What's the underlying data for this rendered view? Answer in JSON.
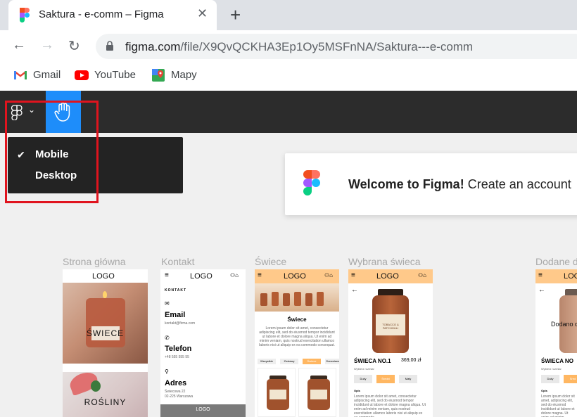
{
  "tab": {
    "title": "Saktura - e-comm – Figma",
    "close": "✕",
    "new": "+"
  },
  "toolbar": {
    "back": "←",
    "forward": "→",
    "reload": "↻",
    "url_domain": "figma.com",
    "url_path": "/file/X9QvQCKHA3Ep1Oy5MSFnNA/Saktura---e-comm"
  },
  "bookmarks": [
    {
      "label": "Gmail"
    },
    {
      "label": "YouTube"
    },
    {
      "label": "Mapy"
    }
  ],
  "dropdown": {
    "items": [
      {
        "label": "Mobile",
        "checked": true
      },
      {
        "label": "Desktop",
        "checked": false
      }
    ]
  },
  "welcome": {
    "bold": "Welcome to Figma!",
    "rest": " Create an account"
  },
  "frames": [
    {
      "label": "Strona główna"
    },
    {
      "label": "Kontakt"
    },
    {
      "label": "Świece"
    },
    {
      "label": "Wybrana świeca"
    },
    {
      "label": "Dodane d"
    }
  ],
  "home": {
    "logo": "LOGO",
    "tile1": "ŚWIECE",
    "tile2": "ROŚLINY"
  },
  "contact": {
    "logo": "LOGO",
    "heading": "KONTAKT",
    "email_label": "Email",
    "email": "kontakt@firma.com",
    "phone_label": "Telefon",
    "phone": "+48 555 555 55",
    "address_label": "Adres",
    "address1": "Świecowa 22",
    "address2": "02-225 Warszawa",
    "footer_logo": "LOGO"
  },
  "candles": {
    "logo": "LOGO",
    "title": "Świece",
    "desc": "Lorem ipsum dolor sit amet, consectetur adipiscing elit, sed do eiusmod tempor incididunt ut labore et dolore magna aliqua. Ut enim ad minim veniam, quis nostrud exercitation ullamco laboris nisi ut aliquip ex ea commodo consequat.",
    "filters": [
      "Wszystkie",
      "Zestawy",
      "Świece",
      "Drewniane"
    ]
  },
  "selected": {
    "logo": "LOGO",
    "name": "ŚWIECA NO.1",
    "price": "369,00 zł",
    "size_label": "Wybierz rozmiar",
    "sizes": [
      "Duży",
      "Średni",
      "Mały"
    ],
    "desc_label": "Opis",
    "desc": "Lorem ipsum dolor sit amet, consectetur adipiscing elit, sed do eiusmod tempor incididunt ut labore et dolore magna aliqua. Ut enim ad minim veniam, quis nostrud exercitation ullamco laboris nisi ut aliquip ex ea commodo.",
    "jar_label": "TOBACCO & PATCHOULI"
  },
  "added": {
    "logo": "LOG",
    "overlay": "Dodano d",
    "name": "ŚWIECA NO",
    "size_label": "Wybierz rozmiar",
    "sizes": [
      "Duży",
      "Śred"
    ],
    "desc_label": "Opis",
    "desc": "Lorem ipsum dolor sit amet, adipiscing elit, sed do eiusmod incididunt ut labore et dolore magna. Ut enim ad minim veniam, quis nostrud exercitation ullamco laboris nisi ut."
  },
  "colors": {
    "accent": "#ffb762",
    "figma_blue": "#1e8dfa",
    "highlight_red": "#e0141e",
    "dark_bar": "#2c2c2c"
  }
}
